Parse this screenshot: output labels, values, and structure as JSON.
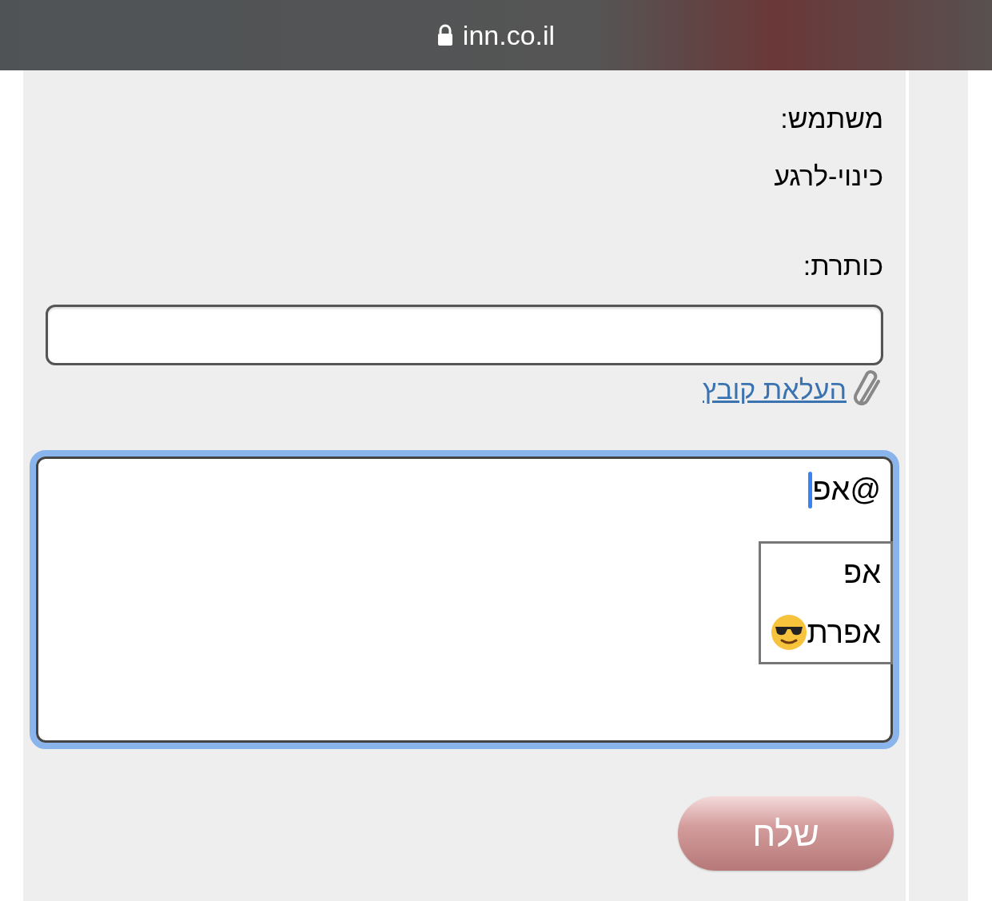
{
  "address_bar": {
    "url": "inn.co.il",
    "secure": true
  },
  "form": {
    "user_label": "משתמש:",
    "user_name": "כינוי-לרגע",
    "title_label": "כותרת:",
    "upload_link": "העלאת קובץ",
    "message": {
      "value": "@אפ",
      "focused": true
    },
    "mention_suggestions": [
      {
        "label": "אפ",
        "emoji": false
      },
      {
        "label": "אפרת",
        "emoji": true
      }
    ],
    "send_button": "שלח"
  }
}
